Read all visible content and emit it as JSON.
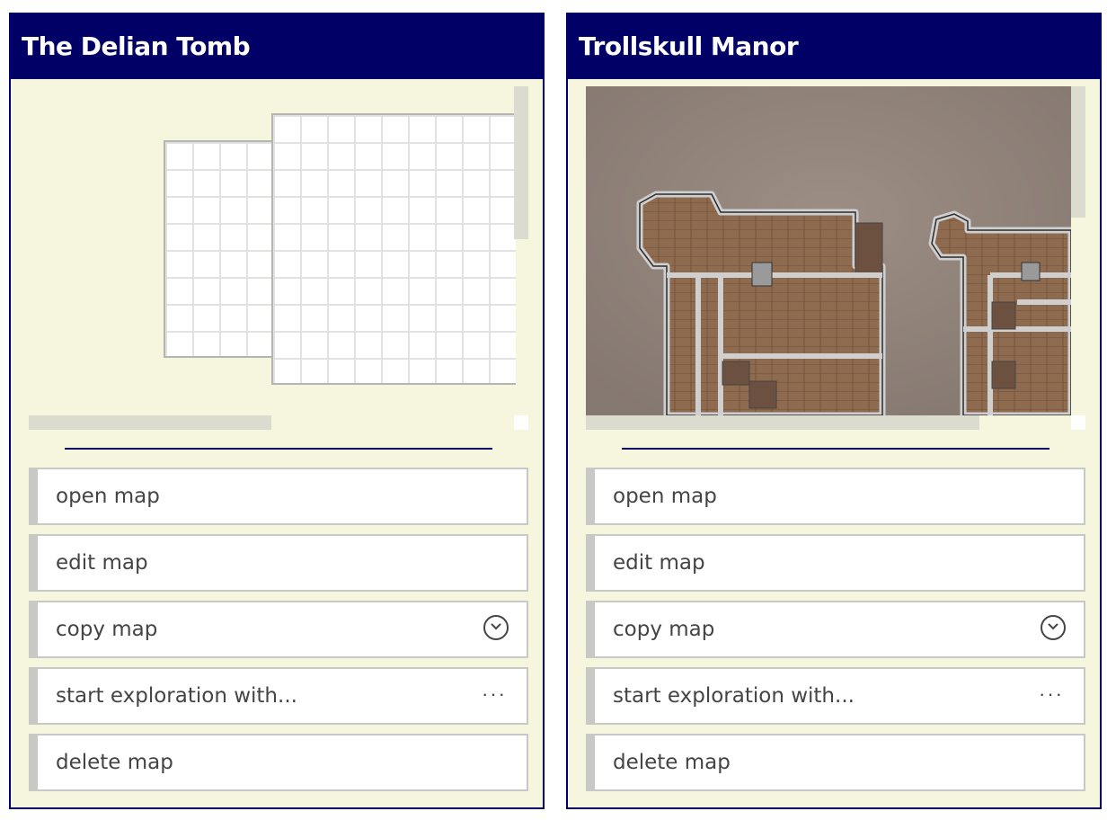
{
  "cards": [
    {
      "title": "The Delian Tomb",
      "preview": "blank-grid-map",
      "actions": [
        {
          "label": "open map"
        },
        {
          "label": "edit map"
        },
        {
          "label": "copy map",
          "icon": "chevron-down-circle-icon"
        },
        {
          "label": "start exploration with...",
          "icon": "ellipsis-icon"
        },
        {
          "label": "delete map"
        }
      ]
    },
    {
      "title": "Trollskull Manor",
      "preview": "floor-plan-map",
      "actions": [
        {
          "label": "open map"
        },
        {
          "label": "edit map"
        },
        {
          "label": "copy map",
          "icon": "chevron-down-circle-icon"
        },
        {
          "label": "start exploration with...",
          "icon": "ellipsis-icon"
        },
        {
          "label": "delete map"
        }
      ]
    }
  ],
  "colors": {
    "header": "#000066",
    "card_bg": "#f6f5dd",
    "action_border": "#c8c8c4",
    "text": "#444444"
  }
}
